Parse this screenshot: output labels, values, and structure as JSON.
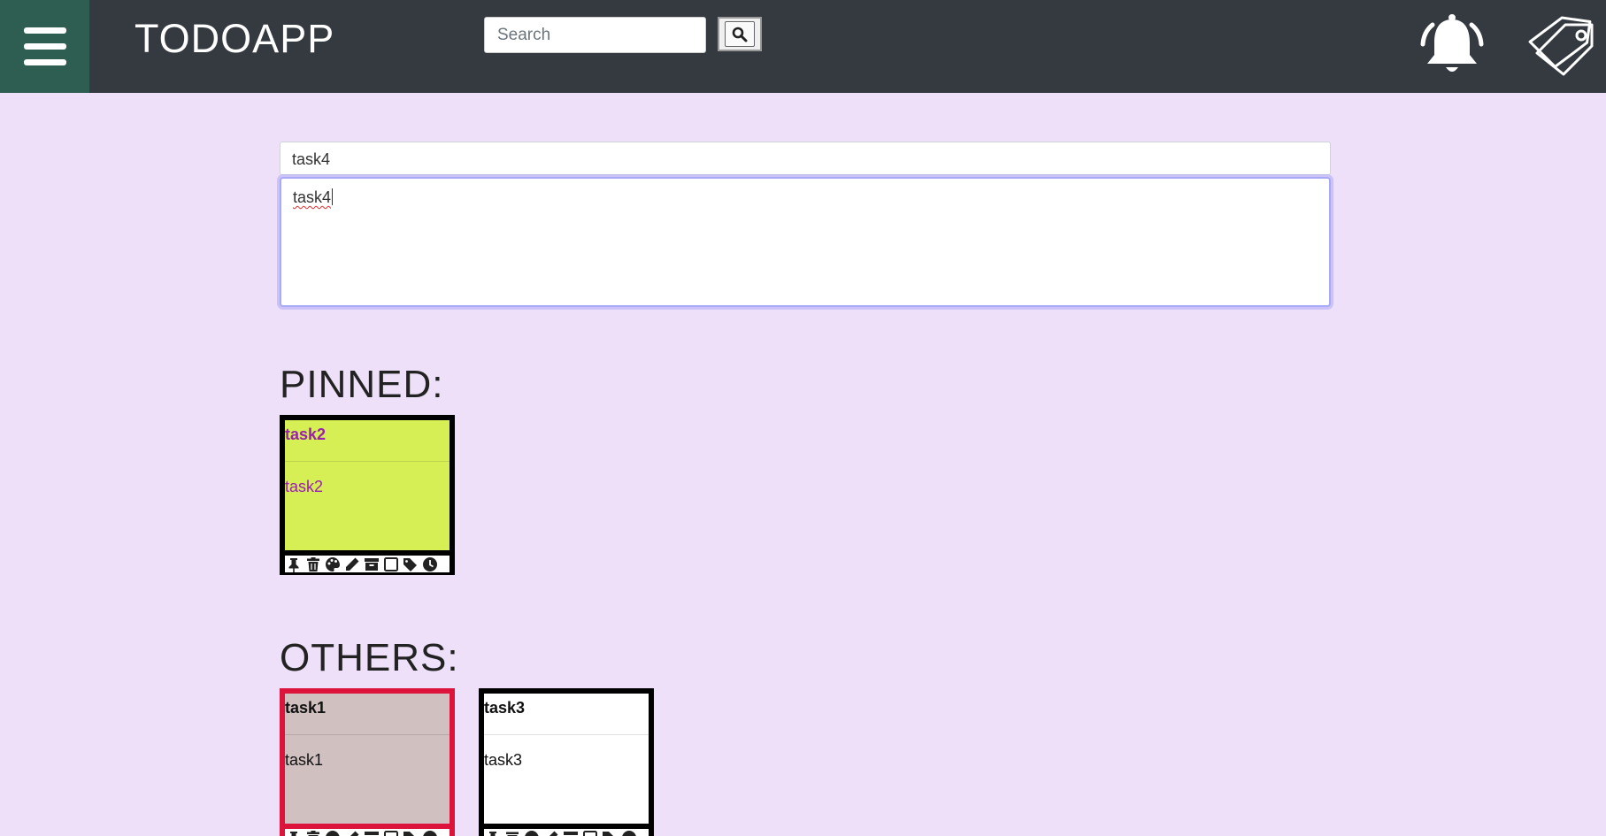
{
  "header": {
    "title": "TODOAPP",
    "search_placeholder": "Search",
    "icons": [
      "menu-icon",
      "search-icon",
      "bell-icon",
      "tag-icon"
    ]
  },
  "create_note": {
    "title_value": "task4",
    "body_value": "task4"
  },
  "sections": {
    "pinned_heading": "PINNED:",
    "others_heading": "OTHERS:"
  },
  "pinned_notes": [
    {
      "title": "task2",
      "body": "task2",
      "background": "#d5ef55",
      "text_color": "#9b1fae",
      "border": "#000000"
    }
  ],
  "other_notes": [
    {
      "title": "task1",
      "body": "task1",
      "background": "#d1c0c0",
      "text_color": "#111111",
      "border": "#dc143c"
    },
    {
      "title": "task3",
      "body": "task3",
      "background": "#ffffff",
      "text_color": "#111111",
      "border": "#000000"
    }
  ],
  "note_toolbar_icons": [
    "pin-icon",
    "trash-icon",
    "palette-icon",
    "pencil-icon",
    "archive-icon",
    "checkbox-icon",
    "tags-icon",
    "clock-icon"
  ],
  "colors": {
    "navbar": "#343a40",
    "menu": "#2e5d52",
    "page": "#ede0f8"
  }
}
